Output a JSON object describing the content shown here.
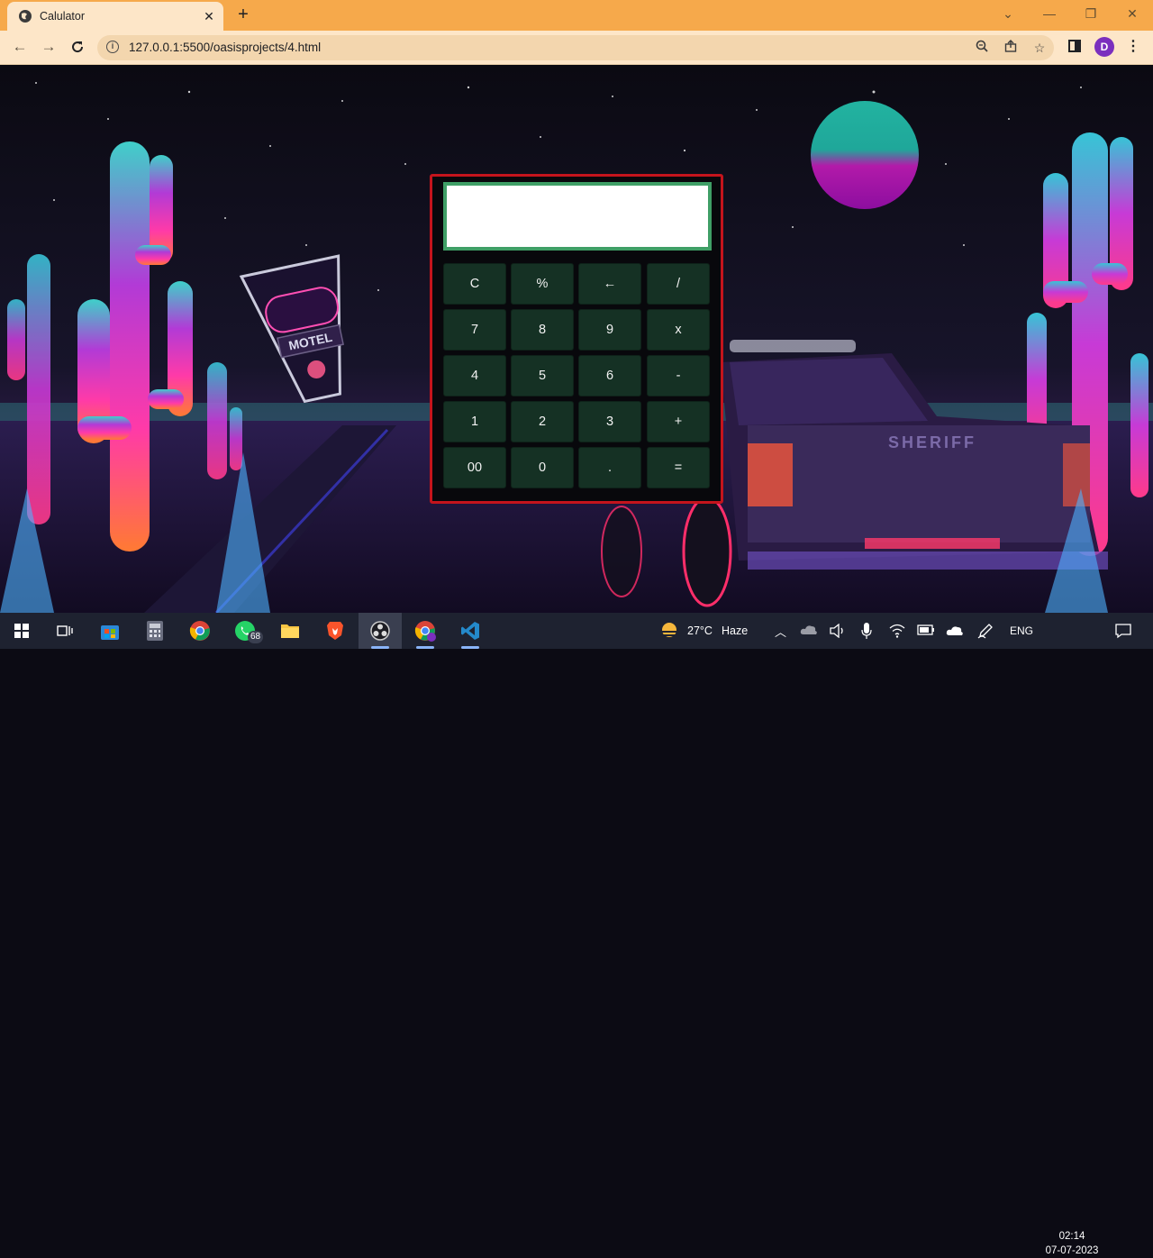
{
  "browser": {
    "tab_title": "Calulator",
    "tab_close": "✕",
    "new_tab": "+",
    "url": "127.0.0.1:5500/oasisprojects/4.html",
    "profile_initial": "D",
    "window_controls": {
      "chevron": "⌄",
      "minimize": "—",
      "restore": "❐",
      "close": "✕"
    }
  },
  "calculator": {
    "display_value": "",
    "keys": [
      "C",
      "%",
      "←",
      "/",
      "7",
      "8",
      "9",
      "x",
      "4",
      "5",
      "6",
      "-",
      "1",
      "2",
      "3",
      "+",
      "00",
      "0",
      ".",
      "="
    ],
    "colors": {
      "frame": "#c4141c",
      "display_border": "#3f9f66",
      "key_bg": "#153124"
    }
  },
  "taskbar": {
    "weather_temp": "27°C",
    "weather_desc": "Haze",
    "language": "ENG",
    "whatsapp_badge": "68",
    "clock_time": "02:14",
    "clock_date": "07-07-2023"
  },
  "scene": {
    "motel_sign": "MOTEL",
    "truck_text": "SHERIFF"
  }
}
